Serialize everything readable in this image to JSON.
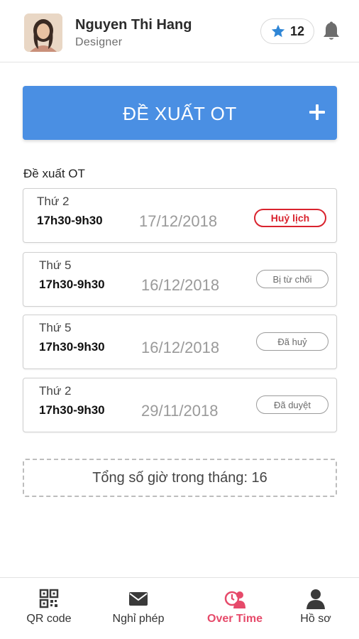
{
  "header": {
    "user_name": "Nguyen Thi Hang",
    "user_role": "Designer",
    "star_count": "12",
    "avatar_icon": "user-avatar-photo",
    "bell_icon": "bell-icon"
  },
  "propose": {
    "label": "ĐỀ XUẤT OT",
    "add_icon": "plus-icon"
  },
  "section_title": "Đề xuất OT",
  "ot_requests": [
    {
      "day": "Thứ 2",
      "time": "17h30-9h30",
      "date": "17/12/2018",
      "status": "Huỷ lịch",
      "status_type": "cancel"
    },
    {
      "day": "Thứ 5",
      "time": "17h30-9h30",
      "date": "16/12/2018",
      "status": "Bị từ chối",
      "status_type": "rejected"
    },
    {
      "day": "Thứ 5",
      "time": "17h30-9h30",
      "date": "16/12/2018",
      "status": "Đã huỷ",
      "status_type": "cancelled"
    },
    {
      "day": "Thứ 2",
      "time": "17h30-9h30",
      "date": "29/11/2018",
      "status": "Đã duyệt",
      "status_type": "approved"
    }
  ],
  "total": "Tổng số giờ trong tháng: 16",
  "nav": [
    {
      "label": "QR code",
      "icon": "qr-code-icon",
      "active": false
    },
    {
      "label": "Nghỉ phép",
      "icon": "mail-icon",
      "active": false
    },
    {
      "label": "Over Time",
      "icon": "overtime-icon",
      "active": true
    },
    {
      "label": "Hồ sơ",
      "icon": "profile-icon",
      "active": false
    }
  ],
  "colors": {
    "primary": "#4a8fe3",
    "danger": "#d9232e",
    "active_nav": "#e64a6a",
    "star": "#2f86d6"
  }
}
